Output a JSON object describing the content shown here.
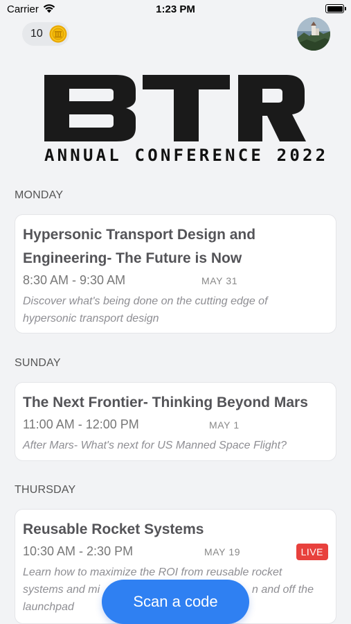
{
  "status_bar": {
    "carrier": "Carrier",
    "time": "1:23 PM"
  },
  "header": {
    "coin_count": "10",
    "coin_icon": "coin-icon",
    "avatar_icon": "avatar"
  },
  "logo": {
    "letters": "BTR",
    "subtitle": "ANNUAL CONFERENCE 2022"
  },
  "sessions": [
    {
      "day": "MONDAY",
      "title_line1": "Hypersonic Transport Design and",
      "title_line2": "Engineering- The Future is Now",
      "time": "8:30 AM - 9:30 AM",
      "date": "MAY 31",
      "desc_line1": "Discover what's being done on the cutting edge of",
      "desc_line2": "hypersonic transport design"
    },
    {
      "day": "SUNDAY",
      "title_line1": "The Next Frontier- Thinking Beyond Mars",
      "time": "11:00 AM - 12:00 PM",
      "date": "MAY 1",
      "desc_line1": "After Mars- What's next for US Manned Space Flight?"
    },
    {
      "day": "THURSDAY",
      "title_line1": "Reusable Rocket Systems",
      "time": "10:30 AM - 2:30 PM",
      "date": "MAY 19",
      "badge": "LIVE",
      "desc_line1": "Learn how to maximize the ROI from reusable rocket",
      "desc_line2": "systems and mi",
      "desc_line2_tail": "n and off the",
      "desc_line3": "launchpad"
    }
  ],
  "scan_button": {
    "label": "Scan a code"
  },
  "colors": {
    "background": "#f2f3f5",
    "accent": "#2f80f2",
    "live": "#e8413d",
    "coin": "#f2b705"
  }
}
